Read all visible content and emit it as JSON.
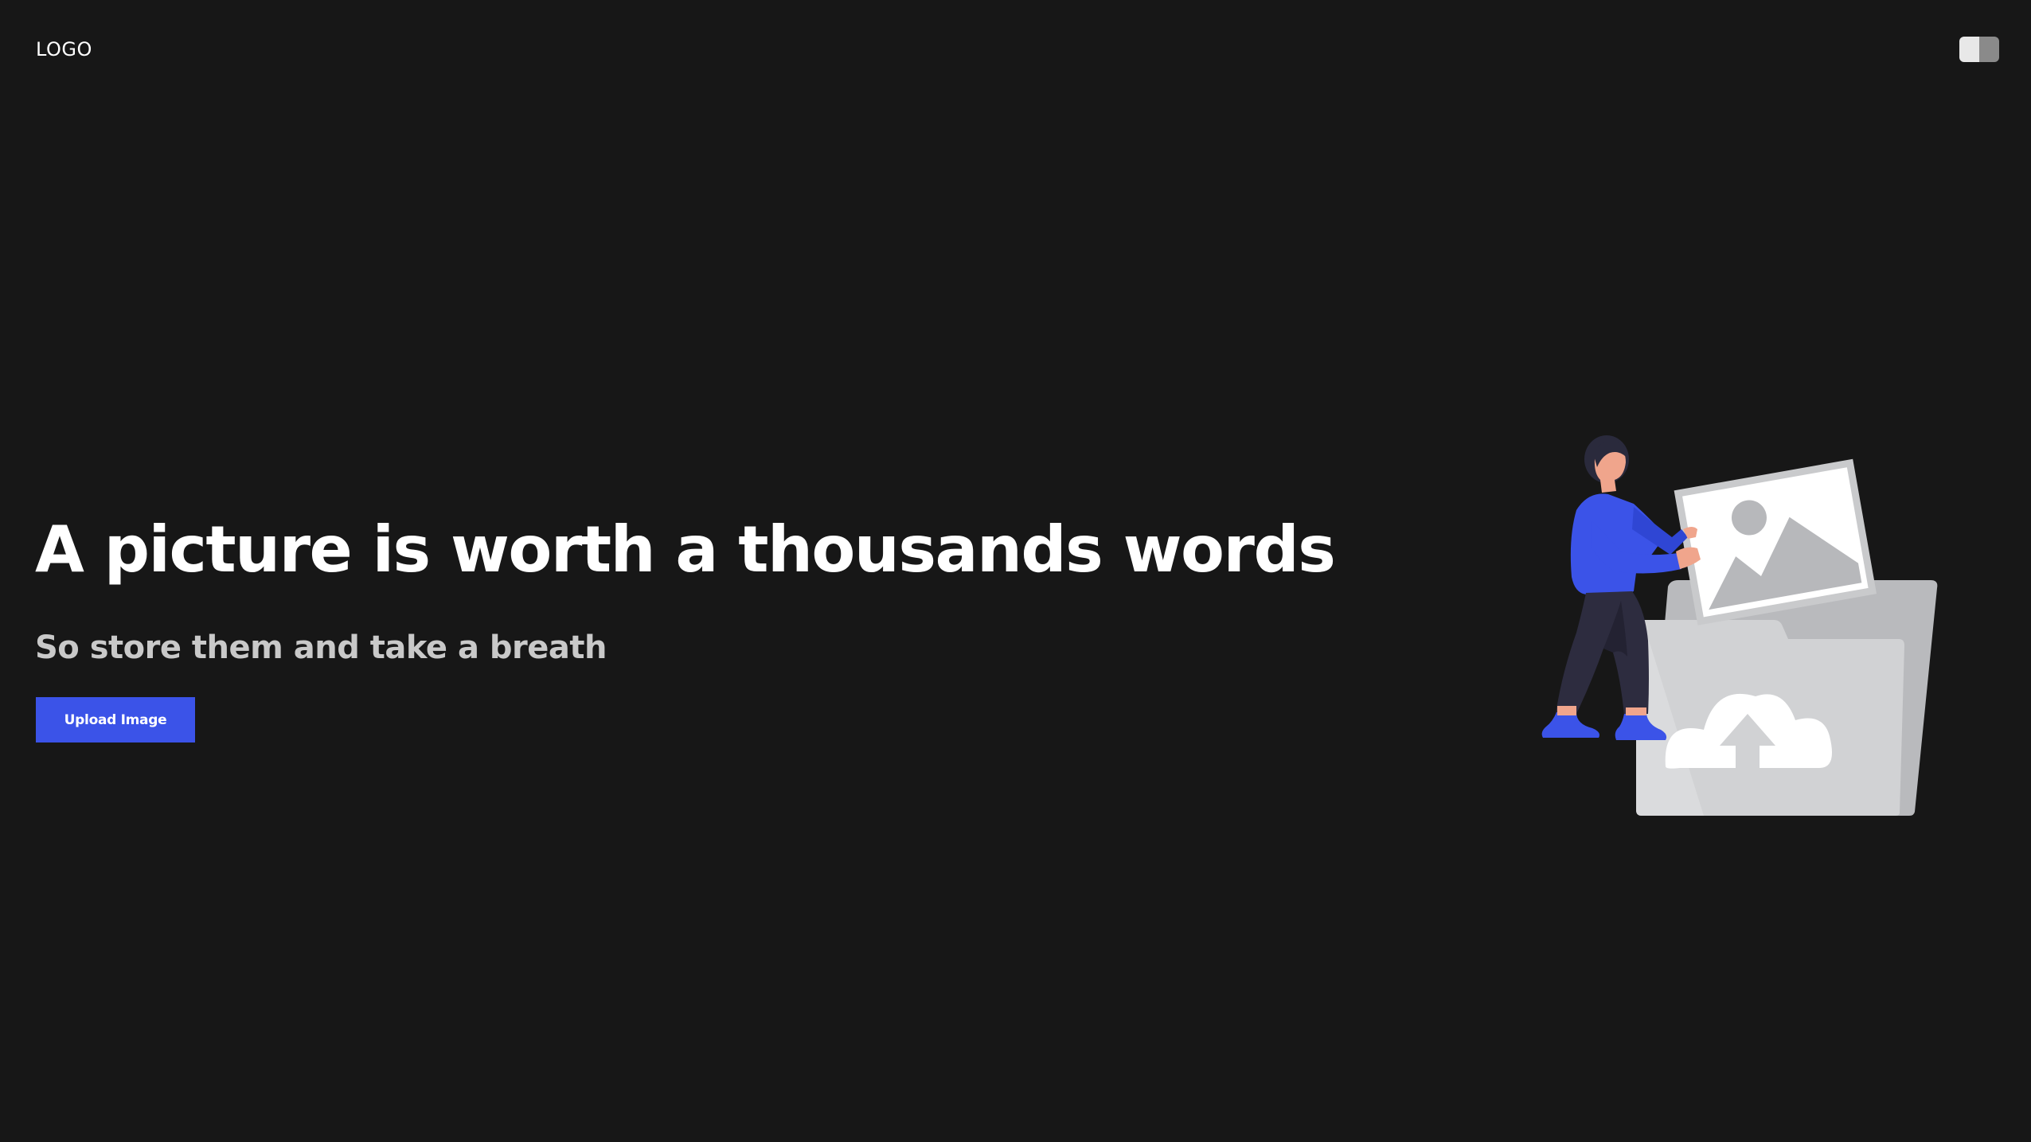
{
  "header": {
    "logo_text": "LOGO",
    "theme_toggle": {
      "icon": "theme-toggle-icon"
    }
  },
  "hero": {
    "headline": "A picture is worth a thousands words",
    "subheadline": "So store them and take a breath",
    "upload_button_label": "Upload Image",
    "illustration": "person-uploading-image-to-cloud-folder"
  },
  "colors": {
    "background": "#171717",
    "accent": "#3b53e8",
    "headline_text": "#ffffff",
    "subheadline_text": "#c9c9c9"
  }
}
